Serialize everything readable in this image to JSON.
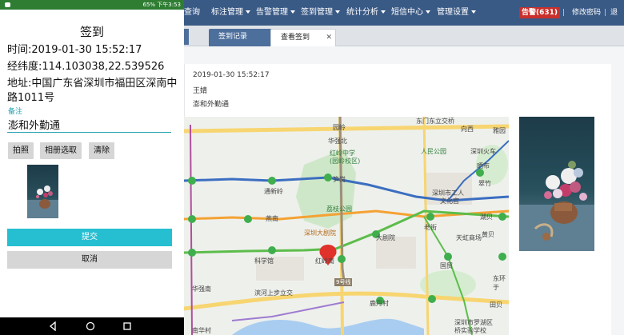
{
  "web": {
    "nav": {
      "items": [
        {
          "label": "查询",
          "dropdown": false
        },
        {
          "label": "标注管理",
          "dropdown": true
        },
        {
          "label": "告警管理",
          "dropdown": true
        },
        {
          "label": "签到管理",
          "dropdown": true
        },
        {
          "label": "统计分析",
          "dropdown": true
        },
        {
          "label": "短信中心",
          "dropdown": true
        },
        {
          "label": "管理设置",
          "dropdown": true
        }
      ],
      "alarm_badge": "告警(631)",
      "change_password": "修改密码",
      "separator": "|",
      "logout": "退出"
    },
    "tabs": [
      {
        "label": "签到记录",
        "close": "✕"
      },
      {
        "label": "查看签到",
        "close": "✕"
      }
    ],
    "detail": {
      "time": "2019-01-30 15:52:17",
      "name": "王婧",
      "note": "澎和外勤通"
    },
    "map_labels": {
      "l1": "园岭",
      "l2": "华强北",
      "l3": "红岭中学",
      "l4": "(园岭校区)",
      "l5": "人民公园",
      "l6": "深圳火车",
      "l7": "笋岗",
      "l8": "通新岭",
      "l9": "荔枝公园",
      "l10": "深圳大剧院",
      "l11": "大剧院",
      "l12": "天虹商场",
      "l13": "深圳市工人",
      "l14": "文化宫",
      "l15": "国贸",
      "l16": "燕南",
      "l17": "科学馆",
      "l18": "红岭南",
      "l19": "9号线",
      "l20": "滨河上步立交",
      "l21": "鹿丹村",
      "l22": "南华村",
      "l23": "华强南",
      "l24": "东门东立交桥",
      "l25": "老街",
      "l26": "湖贝",
      "l27": "东环于",
      "l28": "深圳市罗湖区",
      "l29": "桥实验学校",
      "l30": "向西",
      "l31": "雅园",
      "l32": "晒布",
      "l33": "黄贝",
      "l34": "翠竹",
      "l35": "田贝"
    }
  },
  "phone": {
    "status": "65% 下午3:53",
    "title": "签到",
    "time": "时间:2019-01-30 15:52:17",
    "coords": "经纬度:114.103038,22.539526",
    "address": "地址:中国广东省深圳市福田区深南中路1011号",
    "note_label": "备注",
    "note_value": "澎和外勤通",
    "buttons": {
      "photo": "拍照",
      "album": "相册选取",
      "clear": "清除"
    },
    "submit": "提交",
    "cancel": "取消"
  },
  "colors": {
    "nav_bg": "#3a5a86",
    "alarm_bg": "#c9302c",
    "submit_bg": "#26bfd1",
    "accent": "#26a1b0",
    "status_bar": "#2e7d32"
  }
}
